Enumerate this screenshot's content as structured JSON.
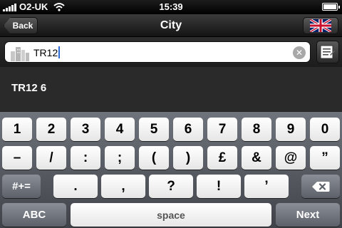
{
  "status_bar": {
    "carrier": "O2-UK",
    "time": "15:39",
    "battery_level": 1.0
  },
  "nav_bar": {
    "back_label": "Back",
    "title": "City",
    "flag_icon": "uk-flag-icon"
  },
  "search": {
    "value": "TR12",
    "city_icon": "city-buildings-icon",
    "clear_icon": "clear-icon",
    "list_icon": "list-edit-icon"
  },
  "results": [
    "TR12 6"
  ],
  "keyboard": {
    "row1": [
      "1",
      "2",
      "3",
      "4",
      "5",
      "6",
      "7",
      "8",
      "9",
      "0"
    ],
    "row2": [
      "–",
      "/",
      ":",
      ";",
      "(",
      ")",
      "£",
      "&",
      "@",
      "”"
    ],
    "row3_mode": "#+=",
    "row3": [
      ".",
      ",",
      "?",
      "!",
      "’"
    ],
    "row4_abc": "ABC",
    "row4_space": "space",
    "row4_next": "Next",
    "delete_icon": "backspace-icon"
  }
}
